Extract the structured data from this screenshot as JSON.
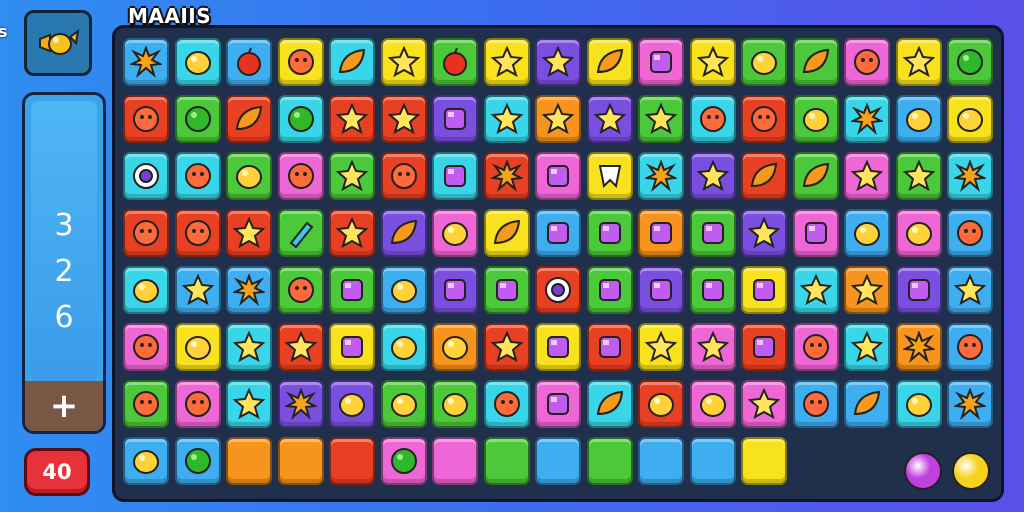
{
  "header": {
    "title": "MAAIIS",
    "edge_glyph": "s"
  },
  "side": {
    "top_button_icon": "candy-icon",
    "score_lines": [
      "3",
      "2",
      "6"
    ],
    "plus_label": "+",
    "counter": "40"
  },
  "colors": {
    "blue": "#3eaef0",
    "green": "#4cc93a",
    "red": "#e84023",
    "yellow": "#f8e21e",
    "cyan": "#38d6e8",
    "purple": "#7a4fe0",
    "pink": "#ef67d6",
    "orange": "#f7941d",
    "dark": "#20304c"
  },
  "grid_colors": [
    [
      "blue",
      "cyan",
      "blue",
      "yellow",
      "cyan",
      "yellow",
      "green",
      "yellow",
      "purple",
      "yellow",
      "pink",
      "yellow",
      "green",
      "green",
      "pink",
      "yellow",
      "green"
    ],
    [
      "red",
      "green",
      "red",
      "cyan",
      "red",
      "red",
      "purple",
      "cyan",
      "orange",
      "purple",
      "green",
      "cyan",
      "red",
      "green",
      "cyan",
      "blue",
      "yellow"
    ],
    [
      "cyan",
      "cyan",
      "green",
      "pink",
      "green",
      "red",
      "cyan",
      "red",
      "pink",
      "yellow",
      "cyan",
      "purple",
      "red",
      "green",
      "pink",
      "green",
      "cyan"
    ],
    [
      "red",
      "red",
      "red",
      "green",
      "red",
      "purple",
      "pink",
      "yellow",
      "blue",
      "green",
      "orange",
      "green",
      "purple",
      "pink",
      "blue",
      "pink",
      "blue"
    ],
    [
      "cyan",
      "blue",
      "blue",
      "green",
      "green",
      "blue",
      "purple",
      "green",
      "red",
      "green",
      "purple",
      "green",
      "yellow",
      "cyan",
      "orange",
      "purple",
      "blue"
    ],
    [
      "pink",
      "yellow",
      "cyan",
      "red",
      "yellow",
      "cyan",
      "orange",
      "red",
      "yellow",
      "red",
      "yellow",
      "pink",
      "red",
      "pink",
      "cyan",
      "orange",
      "blue"
    ],
    [
      "green",
      "pink",
      "cyan",
      "purple",
      "purple",
      "green",
      "green",
      "cyan",
      "pink",
      "cyan",
      "red",
      "pink",
      "pink",
      "blue",
      "blue",
      "cyan",
      "blue"
    ],
    [
      "blue",
      "blue",
      "orange",
      "orange",
      "red",
      "pink",
      "pink",
      "green",
      "blue",
      "green",
      "blue",
      "blue",
      "yellow",
      "dark",
      "dark",
      "dark",
      "dark"
    ]
  ],
  "grid_icons": [
    [
      "splat",
      "blob",
      "apple",
      "face",
      "leaf",
      "star",
      "apple",
      "star",
      "star",
      "leaf",
      "gem",
      "star",
      "blob",
      "leaf",
      "face",
      "star",
      "circle"
    ],
    [
      "face",
      "circle",
      "leaf",
      "circle",
      "star",
      "star",
      "gem",
      "star",
      "star",
      "star",
      "star",
      "face",
      "face",
      "blob",
      "splat",
      "blob",
      "blob"
    ],
    [
      "ring",
      "face",
      "blob",
      "face",
      "star",
      "face",
      "gem",
      "splat",
      "gem",
      "tooth",
      "splat",
      "star",
      "leaf",
      "leaf",
      "star",
      "star",
      "splat"
    ],
    [
      "face",
      "face",
      "star",
      "pencil",
      "star",
      "leaf",
      "blob",
      "leaf",
      "gem",
      "gem",
      "gem",
      "gem",
      "star",
      "gem",
      "blob",
      "blob",
      "face"
    ],
    [
      "blob",
      "star",
      "splat",
      "face",
      "gem",
      "blob",
      "gem",
      "gem",
      "ring",
      "gem",
      "gem",
      "gem",
      "gem",
      "star",
      "star",
      "gem",
      "star"
    ],
    [
      "face",
      "blob",
      "star",
      "star",
      "gem",
      "blob",
      "blob",
      "star",
      "gem",
      "gem",
      "star",
      "star",
      "gem",
      "face",
      "star",
      "splat",
      "face"
    ],
    [
      "face",
      "face",
      "star",
      "splat",
      "blob",
      "blob",
      "blob",
      "face",
      "gem",
      "leaf",
      "blob",
      "blob",
      "star",
      "face",
      "leaf",
      "blob",
      "splat"
    ],
    [
      "blob",
      "circle",
      "none",
      "none",
      "none",
      "circle",
      "none",
      "none",
      "none",
      "none",
      "none",
      "none",
      "none",
      "none",
      "none",
      "none",
      "none"
    ]
  ],
  "balls": [
    {
      "name": "purple-ball-icon",
      "color": "#c23fe0"
    },
    {
      "name": "candy-ball-icon",
      "color": "#f6d21e"
    }
  ]
}
